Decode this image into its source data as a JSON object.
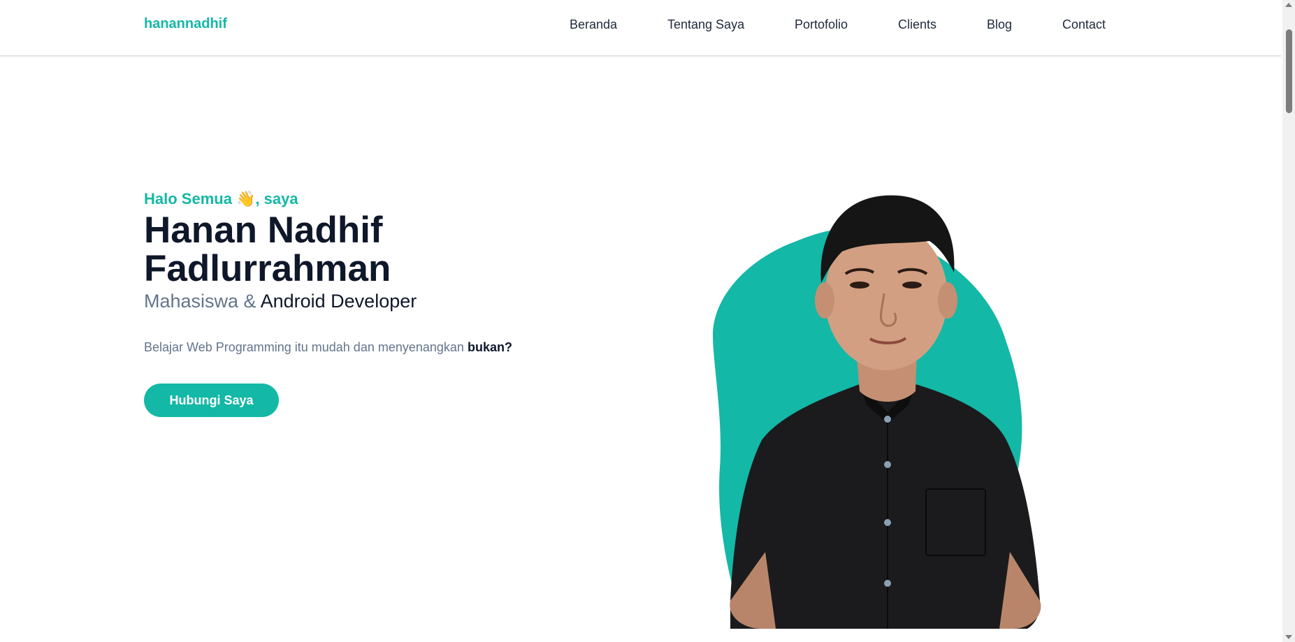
{
  "nav": {
    "brand": "hanannadhif",
    "links": [
      "Beranda",
      "Tentang Saya",
      "Portofolio",
      "Clients",
      "Blog",
      "Contact"
    ]
  },
  "hero": {
    "greeting": "Halo Semua 👋, saya",
    "name": "Hanan Nadhif Fadlurrahman",
    "role_primary": "Mahasiswa &",
    "role_secondary": "Android Developer",
    "tagline_text": "Belajar Web Programming itu mudah dan menyenangkan",
    "tagline_emphasis": "bukan?",
    "cta_label": "Hubungi Saya"
  },
  "colors": {
    "accent": "#14b8a6",
    "heading": "#0f172a",
    "muted": "#64748b"
  }
}
